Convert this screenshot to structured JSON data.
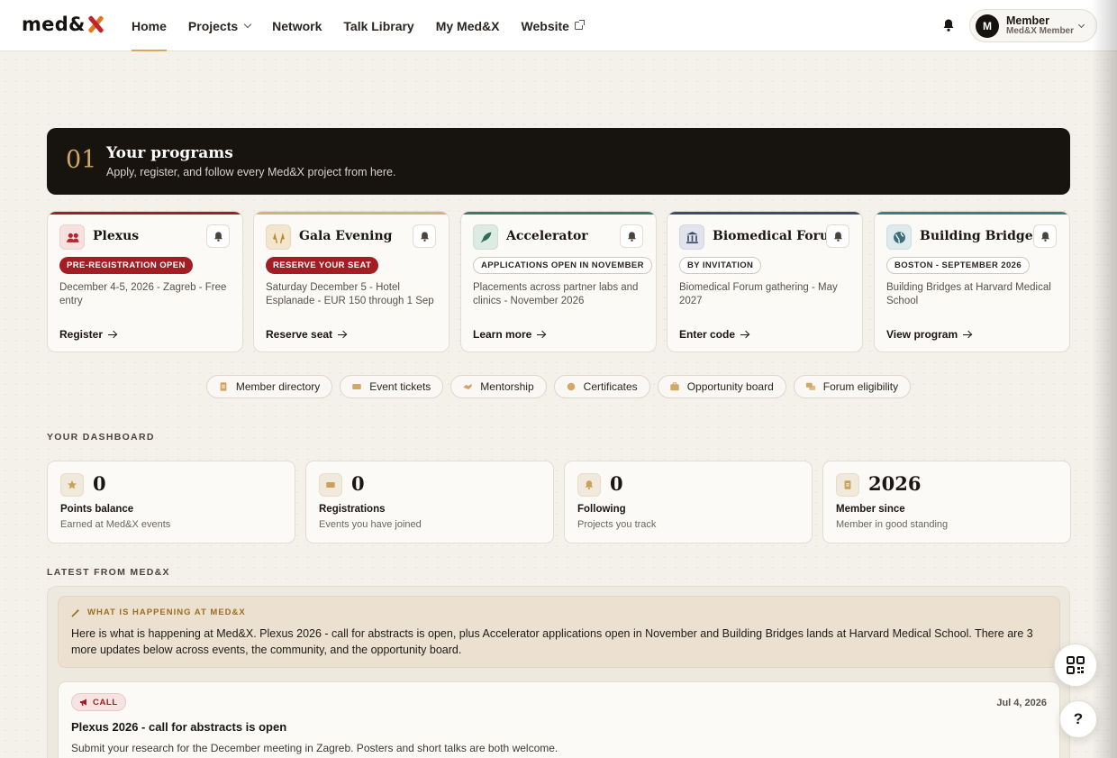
{
  "nav": {
    "brand": "med&",
    "links": [
      {
        "label": "Home"
      },
      {
        "label": "Projects"
      },
      {
        "label": "Network"
      },
      {
        "label": "Talk Library"
      },
      {
        "label": "My Med&X"
      },
      {
        "label": "Website"
      }
    ],
    "member_name": "Member",
    "member_role": "Med&X Member",
    "avatar_initial": "M"
  },
  "programs": {
    "number": "01",
    "title": "Your programs",
    "subtitle": "Apply, register, and follow every Med&X project from here.",
    "cards": [
      {
        "title": "Plexus",
        "badge": "PRE-REGISTRATION OPEN",
        "badge_style": "filled",
        "desc": "December 4-5, 2026 - Zagreb - Free entry",
        "cta": "Register",
        "accent": "#a31d24",
        "icon": "people-icon",
        "icon_bg": "#f7e1df",
        "icon_color": "#b2262d"
      },
      {
        "title": "Gala Evening",
        "badge": "RESERVE YOUR SEAT",
        "badge_style": "filled",
        "desc": "Saturday December 5 - Hotel Esplanade - EUR 150 through 1 Sep",
        "cta": "Reserve seat",
        "accent": "#d0b27a",
        "icon": "glasses-icon",
        "icon_bg": "#f3e6cd",
        "icon_color": "#b98a3a"
      },
      {
        "title": "Accelerator",
        "badge": "APPLICATIONS OPEN IN NOVEMBER",
        "badge_style": "outline",
        "desc": "Placements across partner labs and clinics - November 2026",
        "cta": "Learn more",
        "accent": "#3e7a63",
        "icon": "rocket-icon",
        "icon_bg": "#dcebe3",
        "icon_color": "#2f6b55"
      },
      {
        "title": "Biomedical Forum",
        "badge": "BY INVITATION",
        "badge_style": "outline",
        "desc": "Biomedical Forum gathering - May 2027",
        "cta": "Enter code",
        "accent": "#3e4a6b",
        "icon": "institution-icon",
        "icon_bg": "#e1e4ec",
        "icon_color": "#3e4a6b"
      },
      {
        "title": "Building Bridges",
        "badge": "BOSTON - SEPTEMBER 2026",
        "badge_style": "outline",
        "desc": "Building Bridges at Harvard Medical School",
        "cta": "View program",
        "accent": "#3f7b86",
        "icon": "globe-icon",
        "icon_bg": "#dfeaec",
        "icon_color": "#3a6f79"
      }
    ]
  },
  "chips": [
    {
      "label": "Member directory",
      "icon": "id-card-icon"
    },
    {
      "label": "Event tickets",
      "icon": "ticket-icon"
    },
    {
      "label": "Mentorship",
      "icon": "handshake-icon"
    },
    {
      "label": "Certificates",
      "icon": "medal-icon"
    },
    {
      "label": "Opportunity board",
      "icon": "briefcase-icon"
    },
    {
      "label": "Forum eligibility",
      "icon": "chat-icon"
    }
  ],
  "dashboard": {
    "heading": "YOUR DASHBOARD",
    "stats": [
      {
        "value": "0",
        "label": "Points balance",
        "sub": "Earned at Med&X events",
        "icon": "star-icon"
      },
      {
        "value": "0",
        "label": "Registrations",
        "sub": "Events you have joined",
        "icon": "ticket-icon"
      },
      {
        "value": "0",
        "label": "Following",
        "sub": "Projects you track",
        "icon": "bell-icon"
      },
      {
        "value": "2026",
        "label": "Member since",
        "sub": "Member in good standing",
        "icon": "id-card-icon"
      }
    ]
  },
  "latest": {
    "heading": "LATEST FROM MED&X",
    "summary_tag": "WHAT IS HAPPENING AT MED&X",
    "summary_text": "Here is what is happening at Med&X. Plexus 2026 - call for abstracts is open, plus Accelerator applications open in November and Building Bridges lands at Harvard Medical School. There are 3 more updates below across events, the community, and the opportunity board.",
    "news": {
      "badge": "CALL",
      "date": "Jul 4, 2026",
      "title": "Plexus 2026 - call for abstracts is open",
      "body": "Submit your research for the December meeting in Zagreb. Posters and short talks are both welcome."
    }
  },
  "fab": {
    "help_label": "?"
  }
}
